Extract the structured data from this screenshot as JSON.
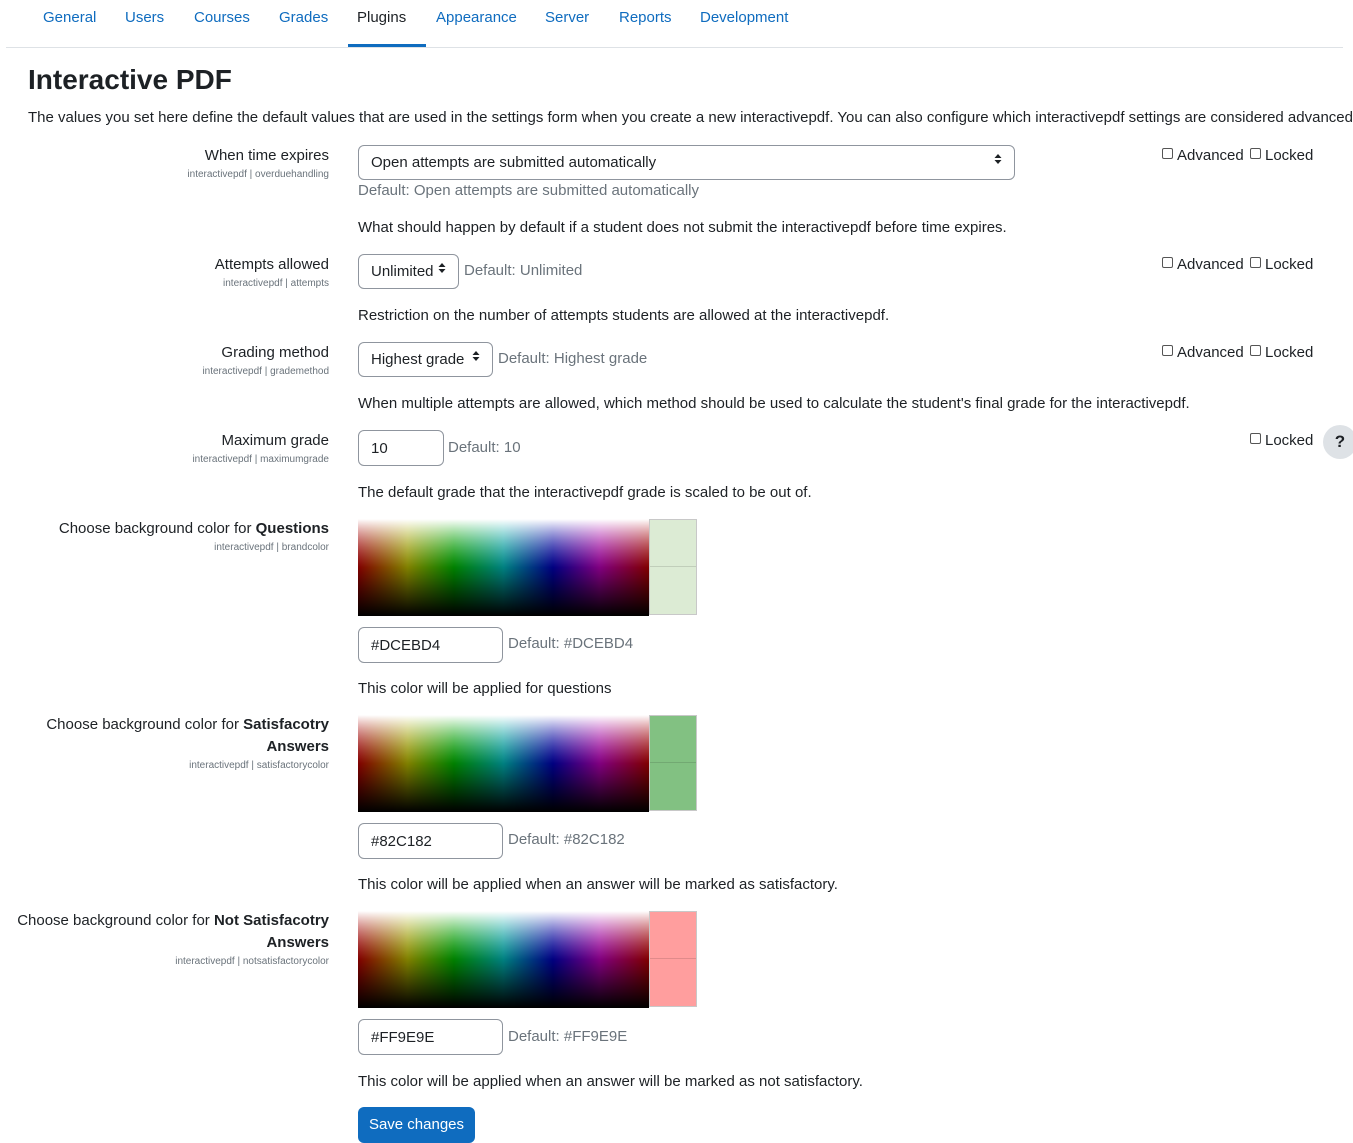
{
  "tabs": [
    "General",
    "Users",
    "Courses",
    "Grades",
    "Plugins",
    "Appearance",
    "Server",
    "Reports",
    "Development"
  ],
  "active_tab": "Plugins",
  "page": {
    "title": "Interactive PDF",
    "intro": "The values you set here define the default values that are used in the settings form when you create a new interactivepdf. You can also configure which interactivepdf settings are considered advanced."
  },
  "settings": {
    "overdue": {
      "label": "When time expires",
      "sublabel": "interactivepdf | overduehandling",
      "value": "Open attempts are submitted automatically",
      "default": "Default: Open attempts are submitted automatically",
      "description": "What should happen by default if a student does not submit the interactivepdf before time expires.",
      "advanced_label": "Advanced",
      "locked_label": "Locked"
    },
    "attempts": {
      "label": "Attempts allowed",
      "sublabel": "interactivepdf | attempts",
      "value": "Unlimited",
      "default": "Default: Unlimited",
      "description": "Restriction on the number of attempts students are allowed at the interactivepdf.",
      "advanced_label": "Advanced",
      "locked_label": "Locked"
    },
    "grademethod": {
      "label": "Grading method",
      "sublabel": "interactivepdf | grademethod",
      "value": "Highest grade",
      "default": "Default: Highest grade",
      "description": "When multiple attempts are allowed, which method should be used to calculate the student's final grade for the interactivepdf.",
      "advanced_label": "Advanced",
      "locked_label": "Locked"
    },
    "maxgrade": {
      "label": "Maximum grade",
      "sublabel": "interactivepdf | maximumgrade",
      "value": "10",
      "default": "Default: 10",
      "description": "The default grade that the interactivepdf grade is scaled to be out of.",
      "locked_label": "Locked"
    },
    "brandcolor": {
      "label_prefix": "Choose background color for ",
      "label_bold": "Questions",
      "sublabel": "interactivepdf | brandcolor",
      "value": "#DCEBD4",
      "swatch": "#dcebd4",
      "default": "Default: #DCEBD4",
      "description": "This color will be applied for questions"
    },
    "satisfactory": {
      "label_prefix": "Choose background color for ",
      "label_bold_1": "Satisfacotry",
      "label_bold_2": "Answers",
      "sublabel": "interactivepdf | satisfactorycolor",
      "value": "#82C182",
      "swatch": "#82c182",
      "default": "Default: #82C182",
      "description": "This color will be applied when an answer will be marked as satisfactory."
    },
    "notsatisfactory": {
      "label_prefix": "Choose background color for ",
      "label_bold_1": "Not Satisfacotry",
      "label_bold_2": "Answers",
      "sublabel": "interactivepdf | notsatisfactorycolor",
      "value": "#FF9E9E",
      "swatch": "#ff9e9e",
      "default": "Default: #FF9E9E",
      "description": "This color will be applied when an answer will be marked as not satisfactory."
    }
  },
  "help_label": "?",
  "save_label": "Save changes"
}
